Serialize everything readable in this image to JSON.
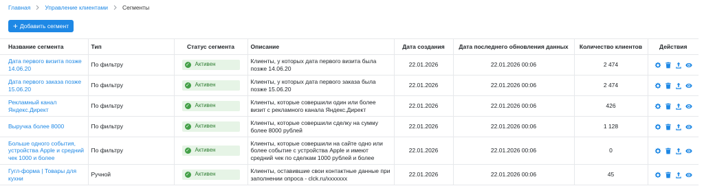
{
  "breadcrumb": {
    "home": "Главная",
    "clients": "Управление клиентами",
    "current": "Сегменты"
  },
  "toolbar": {
    "add_label": "Добавить сегмент"
  },
  "table": {
    "headers": {
      "name": "Название сегмента",
      "type": "Тип",
      "status": "Статус сегмента",
      "description": "Описание",
      "created": "Дата создания",
      "updated": "Дата последнего обновления данных",
      "count": "Количество клиентов",
      "actions": "Действия"
    },
    "rows": [
      {
        "name": "Дата первого визита позже 14.06.20",
        "type": "По фильтру",
        "status": "Активен",
        "description": "Клиенты, у которых дата первого визита была позже 14.06.20",
        "created": "22.01.2026",
        "updated": "22.01.2026 00:06",
        "count": "2 474"
      },
      {
        "name": "Дата первого заказа позже 15.06.20",
        "type": "По фильтру",
        "status": "Активен",
        "description": "Клиенты, у которых дата первого заказа была позже 15.06.20",
        "created": "22.01.2026",
        "updated": "22.01.2026 00:06",
        "count": "2 474"
      },
      {
        "name": "Рекламный канал Яндекс.Директ",
        "type": "По фильтру",
        "status": "Активен",
        "description": "Клиенты, которые совершили один или более визит с рекламного канала Яндекс.Директ",
        "created": "22.01.2026",
        "updated": "22.01.2026 00:06",
        "count": "426"
      },
      {
        "name": "Выручка более 8000",
        "type": "По фильтру",
        "status": "Активен",
        "description": "Клиенты, которые совершили сделку на сумму более 8000 рублей",
        "created": "22.01.2026",
        "updated": "22.01.2026 00:06",
        "count": "1 128"
      },
      {
        "name": "Больше одного события, устройства Apple и средний чек 1000 и более",
        "type": "По фильтру",
        "status": "Активен",
        "description": "Клиенты, которые совершили на сайте одно или более событие с устройства Apple и имеют средний чек по сделкам 1000 рублей и более",
        "created": "22.01.2026",
        "updated": "22.01.2026 00:06",
        "count": "0"
      },
      {
        "name": "Гугл-форма | Товары для кухни",
        "type": "Ручной",
        "status": "Активен",
        "description": "Клиенты, оставившие свои контактные данные при заполнении опроса - clck.ru/xxxxxxx",
        "created": "22.01.2026",
        "updated": "22.01.2026 00:06",
        "count": "45"
      }
    ]
  },
  "colors": {
    "accent": "#1e88e5",
    "status_bg": "#e6f4e6",
    "status_text": "#2e7d32",
    "status_dot": "#43a047"
  },
  "icons": {
    "separator": "chevron-right-icon",
    "add": "plus-icon",
    "status": "check-circle-icon",
    "actions": [
      "gear-icon",
      "trash-icon",
      "upload-icon",
      "eye-icon"
    ]
  }
}
